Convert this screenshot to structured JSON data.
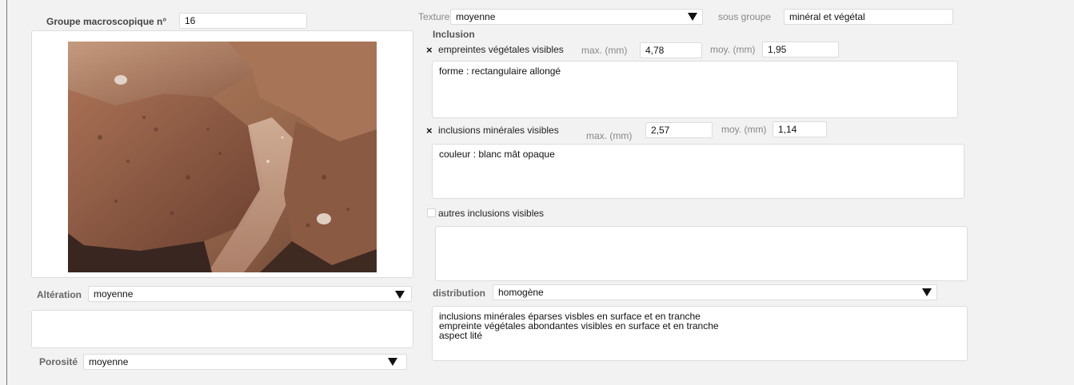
{
  "left": {
    "groupe_label": "Groupe macroscopique n°",
    "groupe_value": "16",
    "alteration_label": "Altération",
    "alteration_value": "moyenne",
    "porosite_label": "Porosité",
    "porosite_value": "moyenne"
  },
  "top": {
    "texture_label": "Texture",
    "texture_value": "moyenne",
    "sous_groupe_label": "sous groupe",
    "sous_groupe_value": "minéral et végétal"
  },
  "inclusion": {
    "heading": "Inclusion",
    "vegetales": {
      "checked_mark": "×",
      "label": "empreintes végétales visibles",
      "max_label": "max. (mm)",
      "max_value": "4,78",
      "moy_label": "moy. (mm)",
      "moy_value": "1,95",
      "note": "forme : rectangulaire allongé"
    },
    "minerales": {
      "checked_mark": "×",
      "label": "inclusions minérales visibles",
      "max_label": "max. (mm)",
      "max_value": "2,57",
      "moy_label": "moy. (mm)",
      "moy_value": "1,14",
      "note": "couleur : blanc mât opaque"
    },
    "autres": {
      "label": "autres inclusions visibles"
    },
    "distribution_label": "distribution",
    "distribution_value": "homogène",
    "distribution_note": "inclusions minérales éparses visbles en surface et en tranche\nempreinte végétales abondantes visibles en surface et en tranche\naspect lité"
  },
  "icons": {
    "dropdown": "dropdown-triangle-icon",
    "checked": "x-checkmark-icon"
  },
  "colors": {
    "background": "#f2f2f2",
    "field": "#ffffff",
    "label_grey": "#888888",
    "label_bold": "#444444"
  }
}
